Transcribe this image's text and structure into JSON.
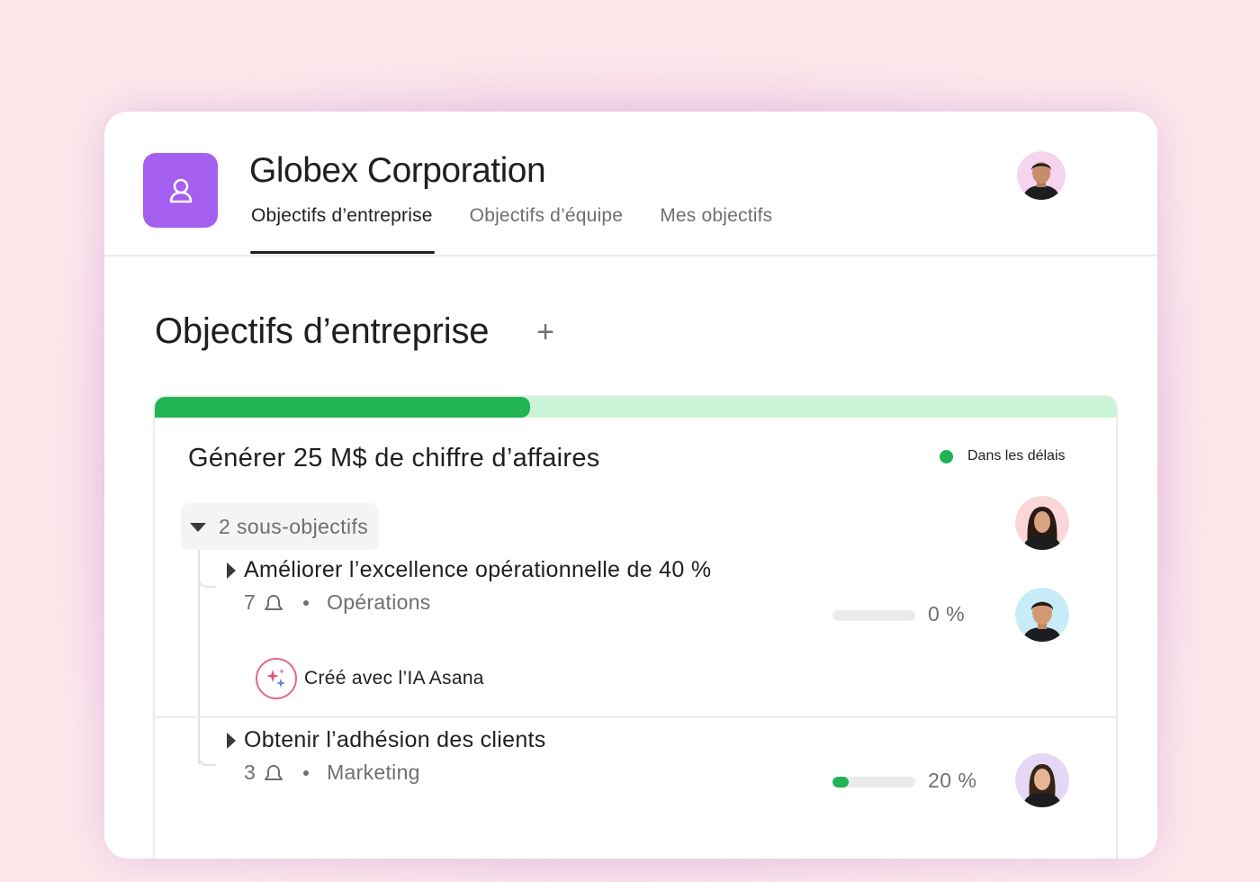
{
  "app": {
    "company_name": "Globex Corporation",
    "logo_icon": "user-circle-icon",
    "brand_color": "#a45ff0"
  },
  "tabs": [
    {
      "label": "Objectifs d’entreprise",
      "active": true
    },
    {
      "label": "Objectifs d’équipe",
      "active": false
    },
    {
      "label": "Mes objectifs",
      "active": false
    }
  ],
  "section": {
    "title": "Objectifs d’entreprise",
    "add_label": "+"
  },
  "goal": {
    "title": "Générer 25 M$ de chiffre d’affaires",
    "progress": 0.39,
    "status": "Dans les délais",
    "status_color": "#22b355",
    "subgoals_toggle": "2 sous-objectifs",
    "subgoals": [
      {
        "title": "Améliorer l’excellence opérationnelle de 40 %",
        "count": "7",
        "team": "Opérations",
        "progress": 0,
        "percent_label": "0 %",
        "ai_label": "Créé avec l’IA Asana"
      },
      {
        "title": "Obtenir l’adhésion des clients",
        "count": "3",
        "team": "Marketing",
        "progress": 0.2,
        "percent_label": "20 %"
      }
    ]
  }
}
